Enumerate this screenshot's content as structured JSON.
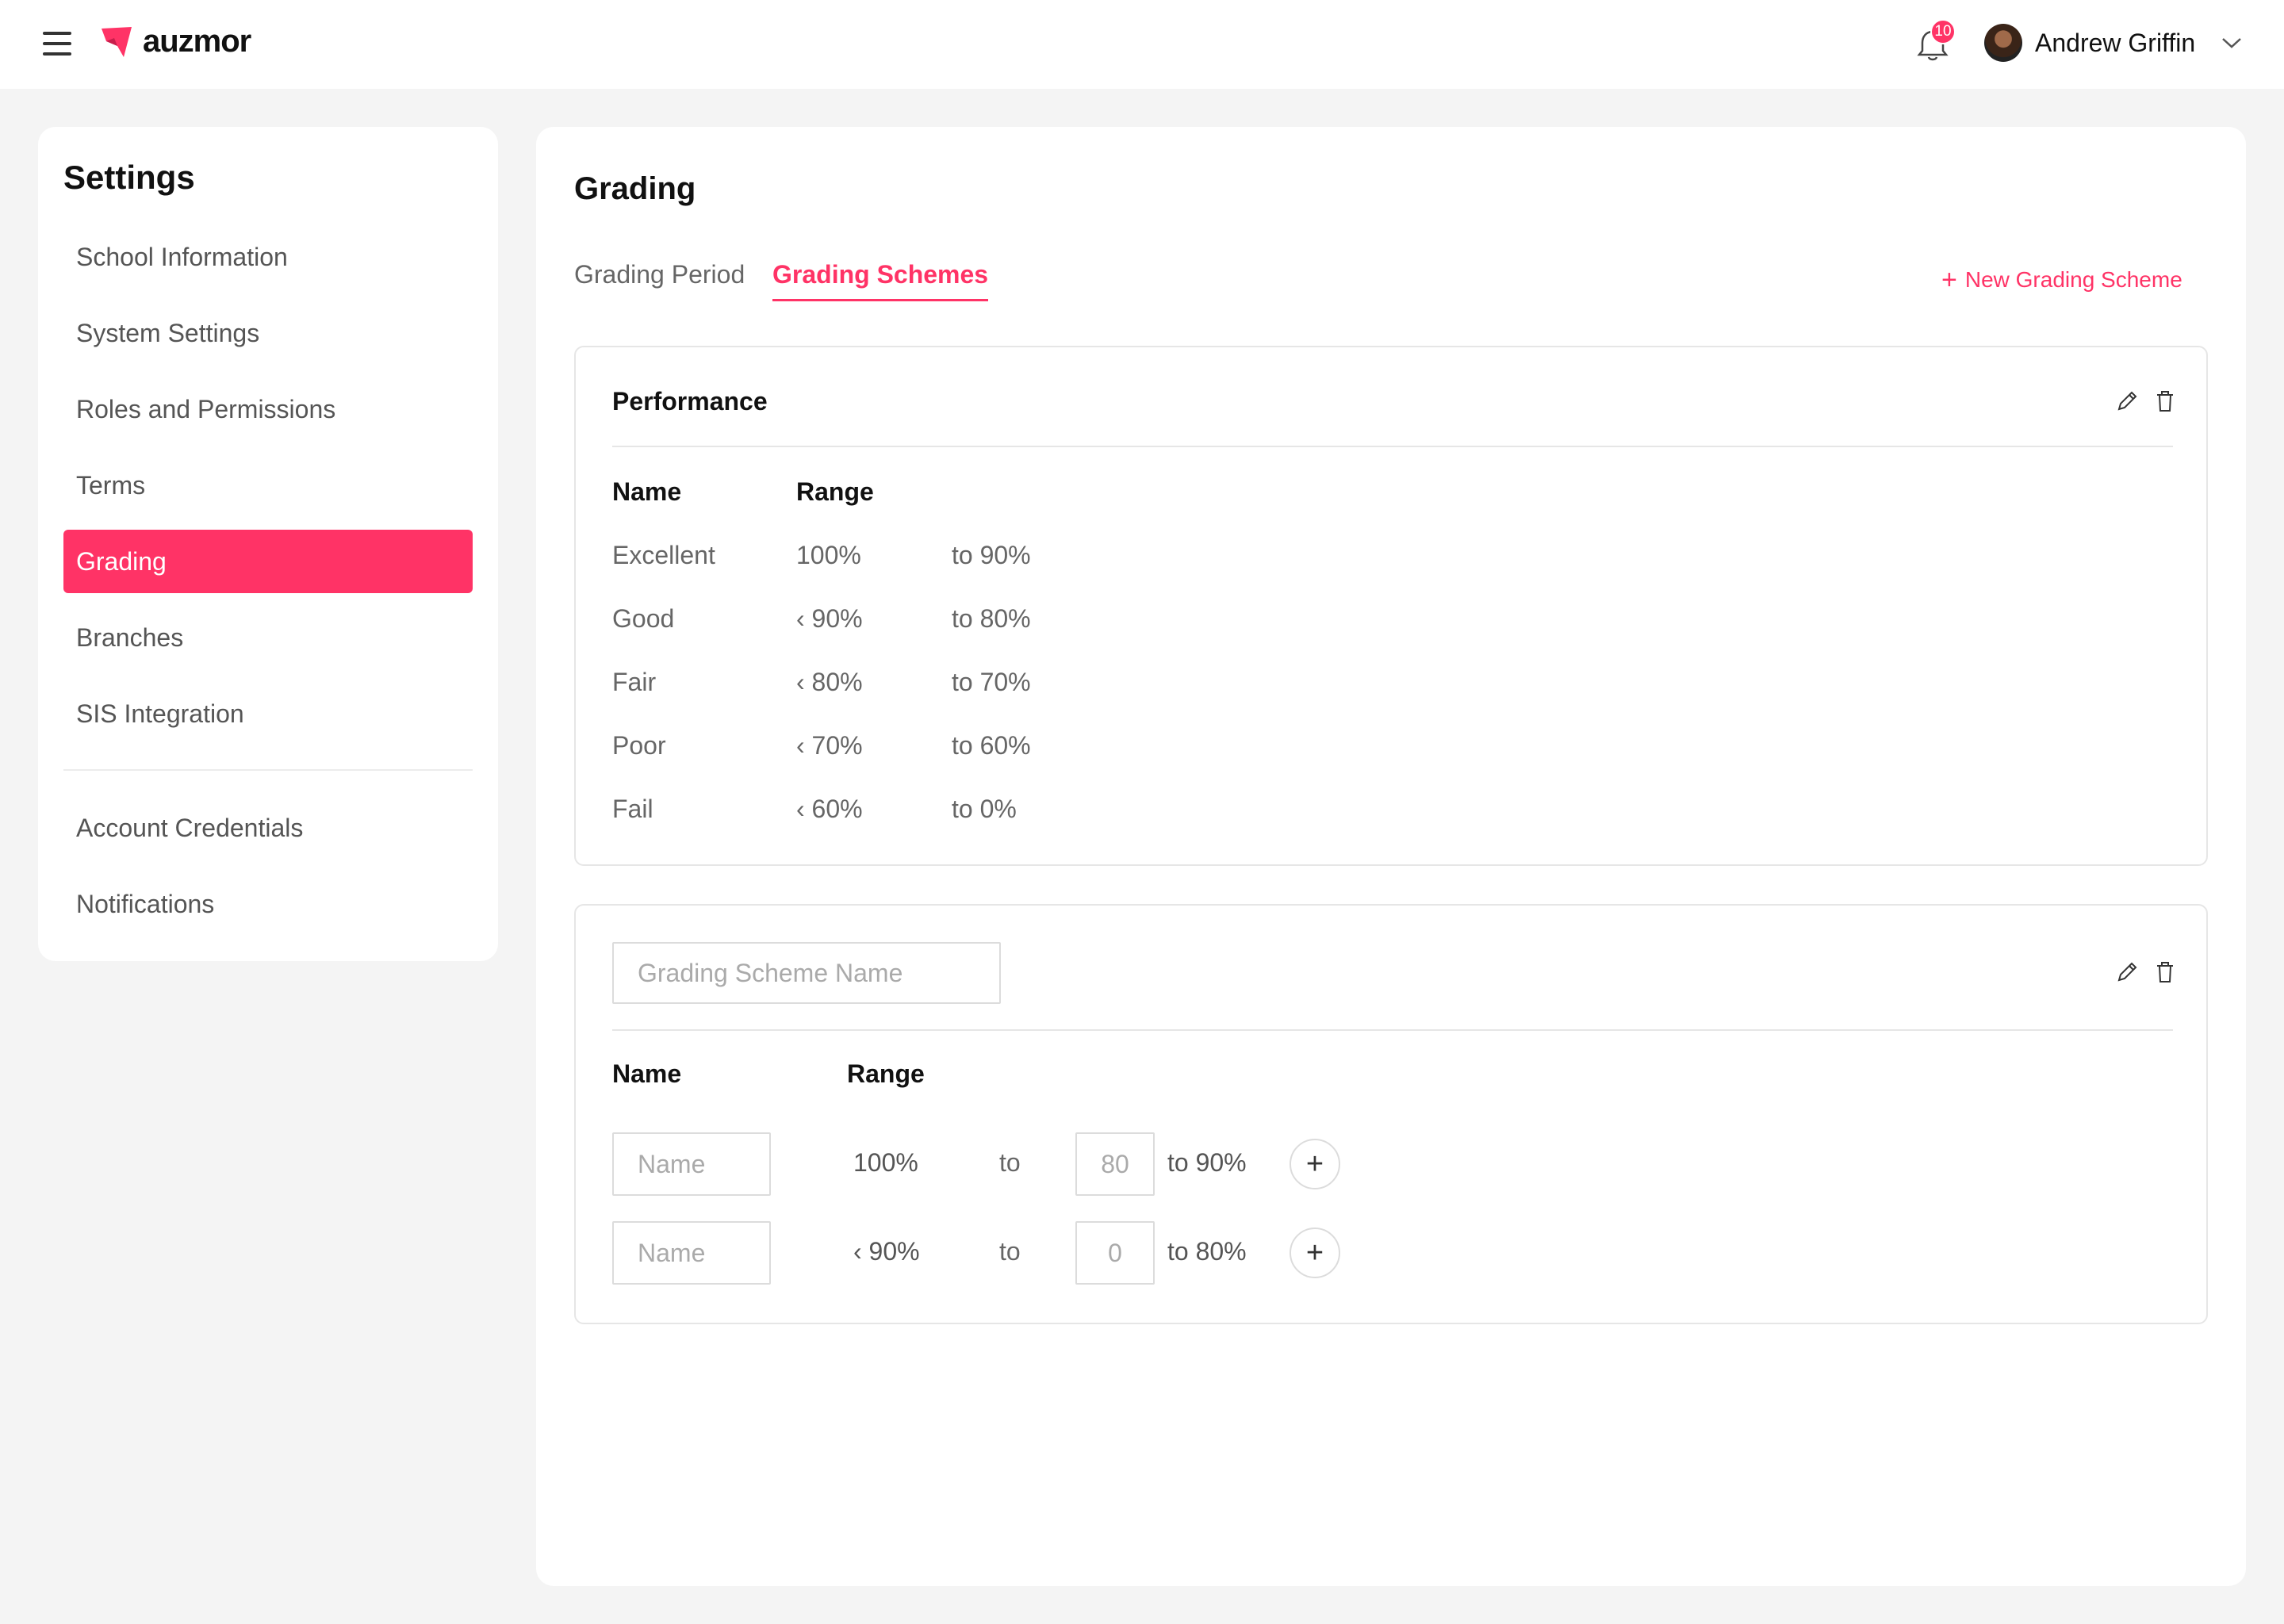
{
  "header": {
    "logo_text": "auzmor",
    "notification_count": "10",
    "user_name": "Andrew Griffin"
  },
  "sidebar": {
    "title": "Settings",
    "items": [
      {
        "label": "School Information"
      },
      {
        "label": "System Settings"
      },
      {
        "label": "Roles and Permissions"
      },
      {
        "label": "Terms"
      },
      {
        "label": "Grading",
        "active": true
      },
      {
        "label": "Branches"
      },
      {
        "label": "SIS Integration"
      },
      {
        "label": "Account Credentials"
      },
      {
        "label": "Notifications"
      }
    ]
  },
  "main": {
    "title": "Grading",
    "tabs": [
      {
        "label": "Grading Period"
      },
      {
        "label": "Grading Schemes",
        "active": true
      }
    ],
    "new_scheme_label": "New Grading Scheme",
    "scheme1": {
      "title": "Performance",
      "col_name": "Name",
      "col_range": "Range",
      "rows": [
        {
          "name": "Excellent",
          "from": "100%",
          "to": "to 90%"
        },
        {
          "name": "Good",
          "from": "‹ 90%",
          "to": "to 80%"
        },
        {
          "name": "Fair",
          "from": "‹ 80%",
          "to": "to 70%"
        },
        {
          "name": "Poor",
          "from": "‹ 70%",
          "to": "to 60%"
        },
        {
          "name": "Fail",
          "from": "‹ 60%",
          "to": "to 0%"
        }
      ]
    },
    "scheme2": {
      "name_placeholder": "Grading Scheme Name",
      "col_name": "Name",
      "col_range": "Range",
      "rows": [
        {
          "name_placeholder": "Name",
          "from": "100%",
          "to_label": "to",
          "to_value": "80",
          "to_text": "to 90%"
        },
        {
          "name_placeholder": "Name",
          "from": "‹ 90%",
          "to_label": "to",
          "to_value": "0",
          "to_text": "to 80%"
        }
      ]
    }
  },
  "colors": {
    "accent": "#ff3366"
  }
}
